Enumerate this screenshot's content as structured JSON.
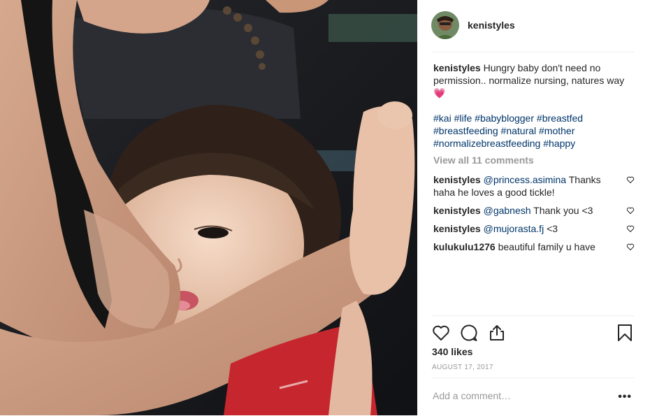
{
  "post": {
    "username": "kenistyles",
    "caption": "Hungry baby don't need no permission.. normalize nursing, natures way 💗",
    "hashtags": [
      "#kai",
      "#life",
      "#babyblogger",
      "#breastfed",
      "#breastfeeding",
      "#natural",
      "#mother",
      "#normalizebreastfeeding",
      "#happy"
    ],
    "view_all_label": "View all 11 comments",
    "comments": [
      {
        "user": "kenistyles",
        "mention": "@princess.asimina",
        "text": " Thanks haha he loves a good tickle!"
      },
      {
        "user": "kenistyles",
        "mention": "@gabnesh",
        "text": " Thank you <3"
      },
      {
        "user": "kenistyles",
        "mention": "@mujorasta.fj",
        "text": " <3"
      },
      {
        "user": "kulukulu1276",
        "mention": "",
        "text": " beautiful family u have"
      }
    ],
    "likes": "340 likes",
    "date": "AUGUST 17, 2017",
    "comment_placeholder": "Add a comment…",
    "more_label": "•••"
  },
  "icons": {
    "like": "heart-outline-icon",
    "comment": "speech-bubble-icon",
    "share": "share-upload-icon",
    "save": "bookmark-icon",
    "comment_like": "small-heart-icon"
  },
  "colors": {
    "username": "#262626",
    "link": "#003569",
    "muted": "#999999",
    "divider": "#efefef"
  }
}
